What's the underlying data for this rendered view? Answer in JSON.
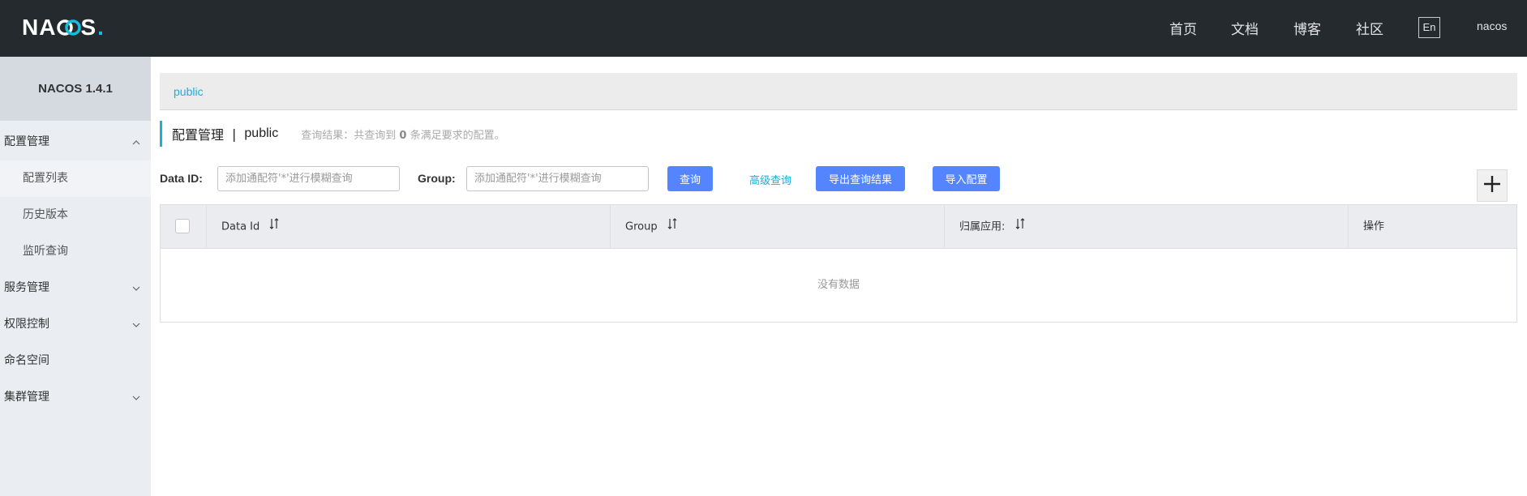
{
  "header": {
    "logo_text_left": "N",
    "logo_text_mid_a": "A",
    "logo_text_right": "S",
    "nav": [
      "首页",
      "文档",
      "博客",
      "社区"
    ],
    "lang": "En",
    "user": "nacos",
    "colors": {
      "bg": "#252a2f",
      "accent": "#12bfe0"
    }
  },
  "sidebar": {
    "title": "NACOS 1.4.1",
    "items": [
      {
        "label": "配置管理",
        "expanded": true,
        "icon": "chevron-up-icon"
      },
      {
        "label": "配置列表",
        "sub": true,
        "active": true
      },
      {
        "label": "历史版本",
        "sub": true
      },
      {
        "label": "监听查询",
        "sub": true
      },
      {
        "label": "服务管理",
        "expanded": false,
        "icon": "chevron-down-icon"
      },
      {
        "label": "权限控制",
        "expanded": false,
        "icon": "chevron-down-icon"
      },
      {
        "label": "命名空间"
      },
      {
        "label": "集群管理",
        "expanded": false,
        "icon": "chevron-down-icon"
      }
    ]
  },
  "main": {
    "breadcrumb": "public",
    "title": "配置管理",
    "separator": "|",
    "namespace": "public",
    "hint_prefix": "查询结果：共查询到",
    "hint_count": "0",
    "hint_suffix": "条满足要求的配置。",
    "filters": {
      "data_id_label": "Data ID:",
      "data_id_placeholder": "添加通配符'*'进行模糊查询",
      "group_label": "Group:",
      "group_placeholder": "添加通配符'*'进行模糊查询",
      "search_button": "查询",
      "advanced_link": "高级查询",
      "export_button": "导出查询结果",
      "import_button": "导入配置"
    },
    "table": {
      "columns": [
        "Data Id",
        "Group",
        "归属应用:",
        "操作"
      ],
      "empty_text": "没有数据"
    },
    "accent_color": "#5584ff",
    "link_color": "#1ab0d8"
  }
}
